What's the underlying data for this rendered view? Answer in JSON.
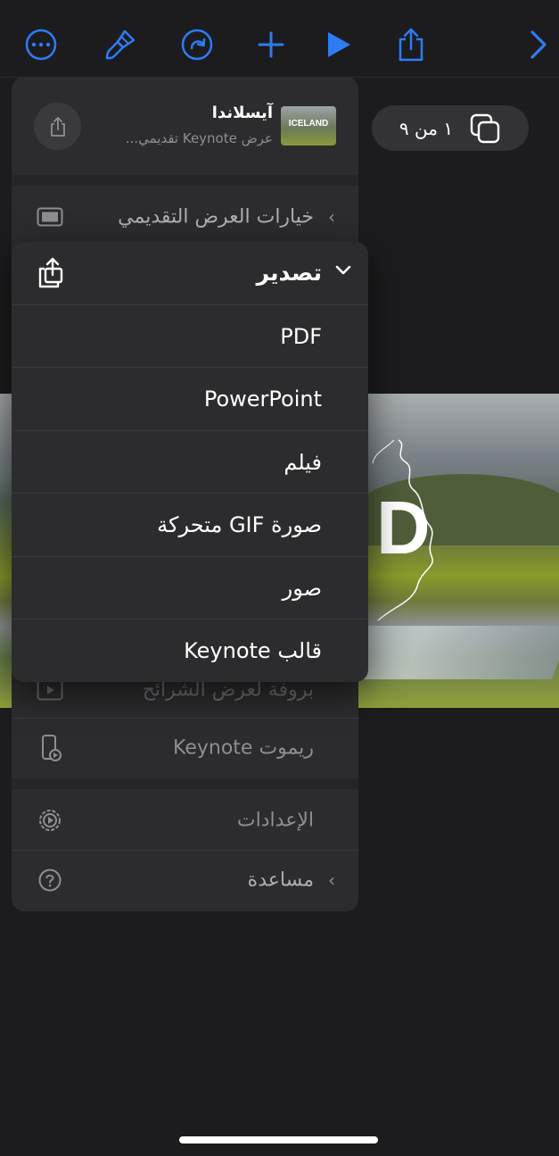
{
  "toolbar": {
    "accent": "#2d7cf6",
    "icons": [
      "more-icon",
      "paintbrush-icon",
      "redo-icon",
      "add-icon",
      "play-icon",
      "share-icon",
      "forward-icon"
    ]
  },
  "slide_counter": {
    "text": "١ من ٩"
  },
  "slide": {
    "visible_letter": "D"
  },
  "document": {
    "title": "آيسلاندا",
    "subtitle": "عرض Keynote تقديمي...",
    "thumbnail_text": "ICELAND"
  },
  "menu": {
    "presentation_options": "خيارات العرض التقديمي",
    "slideshow_rehearsal": "بروفة لعرض الشرائح",
    "keynote_remote": "ريموت Keynote",
    "settings": "الإعدادات",
    "help": "مساعدة"
  },
  "export_menu": {
    "title": "تصدير",
    "items": [
      {
        "label": "PDF"
      },
      {
        "label": "PowerPoint"
      },
      {
        "label": "فيلم"
      },
      {
        "label": "صورة GIF متحركة"
      },
      {
        "label": "صور"
      },
      {
        "label": "قالب Keynote"
      }
    ]
  }
}
